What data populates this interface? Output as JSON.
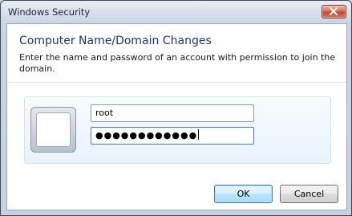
{
  "window": {
    "title": "Windows Security"
  },
  "dialog": {
    "heading": "Computer Name/Domain Changes",
    "description": "Enter the name and password of an account with permission to join the domain."
  },
  "credentials": {
    "username_value": "root",
    "password_masked": "●●●●●●●●●●●●"
  },
  "buttons": {
    "ok_label": "OK",
    "cancel_label": "Cancel"
  },
  "icons": {
    "close": "close-icon",
    "user_tile": "user-tile-icon"
  },
  "colors": {
    "heading": "#1e3287",
    "close_button": "#c2442b",
    "default_button_border": "#3c7fb1",
    "panel_background": "#e8f4fb"
  }
}
